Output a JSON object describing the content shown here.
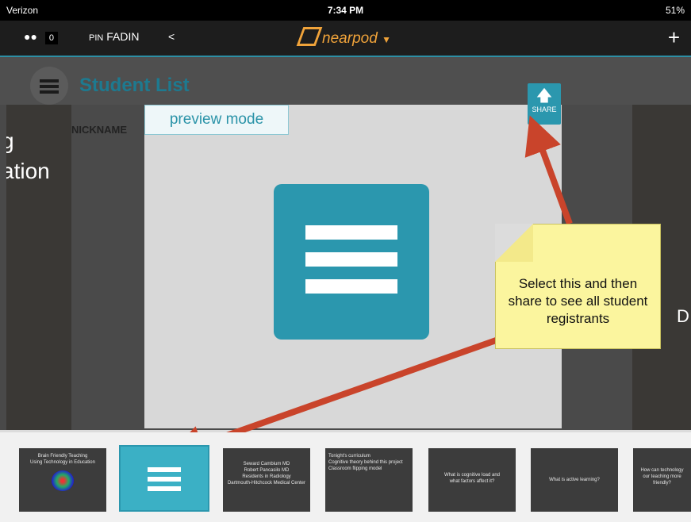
{
  "status": {
    "carrier": "Verizon",
    "time": "7:34 PM",
    "battery": "51%"
  },
  "nav": {
    "student_count": "0",
    "pin_label": "PIN",
    "pin_value": "FADIN",
    "logo": "nearpod",
    "add_label": "+"
  },
  "header": {
    "title": "Student List",
    "column": "NICKNAME"
  },
  "left_partial": [
    "g",
    "ation"
  ],
  "right_partial": "D",
  "preview": "preview mode",
  "share": "SHARE",
  "note": "Select this and then share to see all student registrants",
  "thumbnails": [
    {
      "lines": [
        "Brain Friendly Teaching",
        "Using Technology in Education"
      ]
    },
    {
      "active": true
    },
    {
      "lines": [
        "Seward Cambium MD",
        "Robert Pancasilo MD",
        "",
        "Residents in Radiology",
        "Dartmouth-Hitchcock Medical Center"
      ]
    },
    {
      "lines": [
        "Tonight's curriculum",
        "",
        "Cognitive theory behind this project",
        "Classroom flipping model"
      ]
    },
    {
      "lines": [
        "What is cognitive load and",
        "what factors affect it?"
      ]
    },
    {
      "lines": [
        "What is active learning?"
      ]
    },
    {
      "lines": [
        "How can technology",
        "our teaching more",
        "friendly?"
      ]
    }
  ],
  "colors": {
    "accent": "#2b97ae",
    "logo": "#f0a33a",
    "arrow": "#c9442b"
  }
}
